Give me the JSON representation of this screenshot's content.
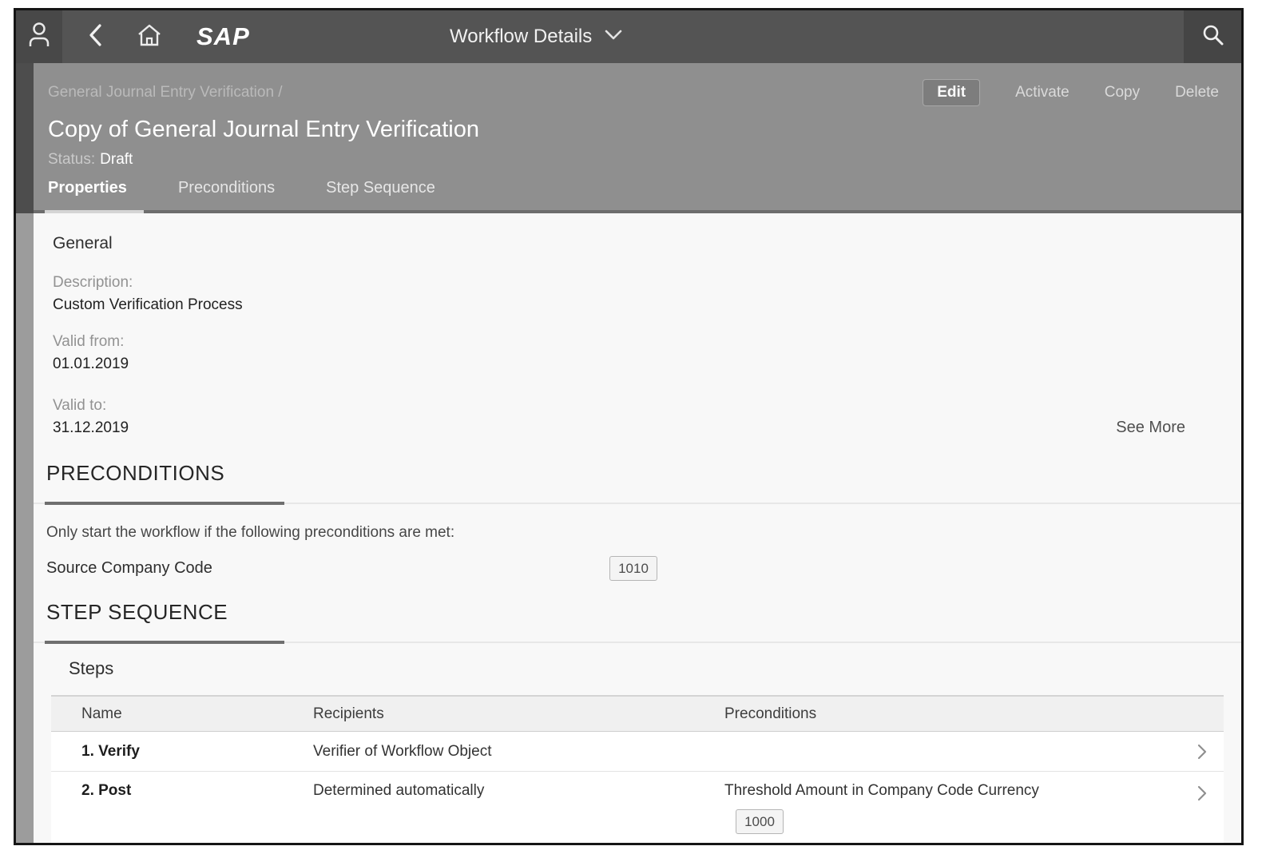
{
  "topbar": {
    "logo": "SAP",
    "title": "Workflow Details"
  },
  "header": {
    "breadcrumb": "General Journal Entry Verification /",
    "title": "Copy of General Journal Entry Verification",
    "status_label": "Status:",
    "status_value": "Draft",
    "tabs": [
      {
        "label": "Properties"
      },
      {
        "label": "Preconditions"
      },
      {
        "label": "Step Sequence"
      }
    ],
    "actions": [
      {
        "label": "Edit"
      },
      {
        "label": "Activate"
      },
      {
        "label": "Copy"
      },
      {
        "label": "Delete"
      }
    ]
  },
  "general": {
    "heading": "General",
    "fields": [
      {
        "label": "Description:",
        "value": "Custom Verification Process"
      },
      {
        "label": "Valid from:",
        "value": "01.01.2019"
      },
      {
        "label": "Valid to:",
        "value": "31.12.2019"
      }
    ],
    "see_more": "See More"
  },
  "preconditions_section": {
    "heading": "PRECONDITIONS",
    "intro": "Only start the workflow if the following preconditions are met:",
    "condition_label": "Source Company Code",
    "condition_value": "1010"
  },
  "step_sequence_section": {
    "heading": "STEP SEQUENCE",
    "table_title": "Steps",
    "columns": [
      "Name",
      "Recipients",
      "Preconditions"
    ],
    "rows": [
      {
        "name": "1. Verify",
        "recipients": "Verifier of Workflow Object",
        "precondition": "",
        "precondition_value": ""
      },
      {
        "name": "2. Post",
        "recipients": "Determined automatically",
        "precondition": "Threshold Amount in Company Code Currency",
        "precondition_value": "1000"
      }
    ]
  },
  "colors": {
    "topbar": "#545454",
    "page_header": "#8f8f8f",
    "card": "#f8f8f8"
  }
}
